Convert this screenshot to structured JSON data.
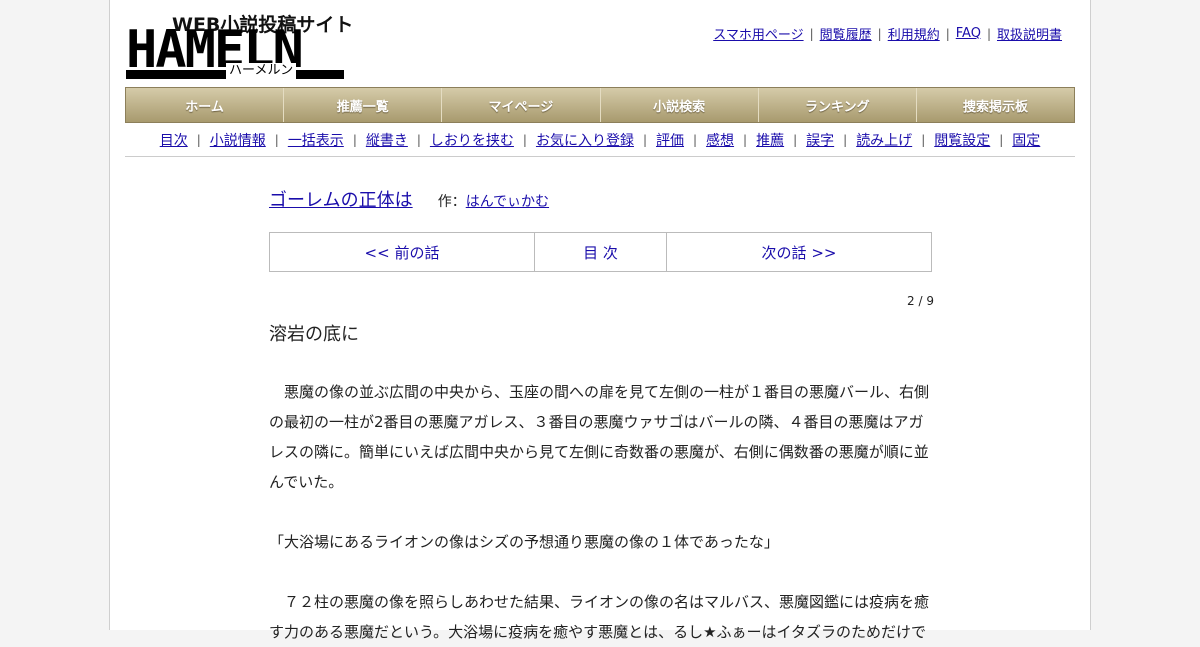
{
  "header": {
    "logo_sub": "WEB小説投稿サイト",
    "logo_main": "HAMELN",
    "logo_kana": "ハーメルン",
    "top_links": [
      "スマホ用ページ",
      "閲覧履歴",
      "利用規約",
      "FAQ",
      "取扱説明書"
    ]
  },
  "main_nav": [
    "ホーム",
    "推薦一覧",
    "マイページ",
    "小説検索",
    "ランキング",
    "捜索掲示板"
  ],
  "sub_nav": [
    "目次",
    "小説情報",
    "一括表示",
    "縦書き",
    "しおりを挟む",
    "お気に入り登録",
    "評価",
    "感想",
    "推薦",
    "誤字",
    "読み上げ",
    "閲覧設定",
    "固定"
  ],
  "novel": {
    "title": "ゴーレムの正体は",
    "author_label": "作：",
    "author": "はんでぃかむ"
  },
  "pager": {
    "prev": "<< 前の話",
    "toc": "目 次",
    "next": "次の話 >>"
  },
  "page_count": "2 / 9",
  "chapter_title": "溶岩の底に",
  "body": [
    "　悪魔の像の並ぶ広間の中央から、玉座の間への扉を見て左側の一柱が１番目の悪魔バール、右側の最初の一柱が2番目の悪魔アガレス、３番目の悪魔ウァサゴはバールの隣、４番目の悪魔はアガレスの隣に。簡単にいえば広間中央から見て左側に奇数番の悪魔が、右側に偶数番の悪魔が順に並んでいた。",
    "",
    "「大浴場にあるライオンの像はシズの予想通り悪魔の像の１体であったな」",
    "",
    "　７２柱の悪魔の像を照らしあわせた結果、ライオンの像の名はマルバス、悪魔図鑑には疫病を癒す力のある悪魔だという。大浴場に疫病を癒やす悪魔とは、るし★ふぁーはイタズラのためだけで"
  ],
  "colors": {
    "link": "#1a0dab",
    "nav_top": "#d5cba9",
    "nav_bottom": "#a89a6e"
  }
}
